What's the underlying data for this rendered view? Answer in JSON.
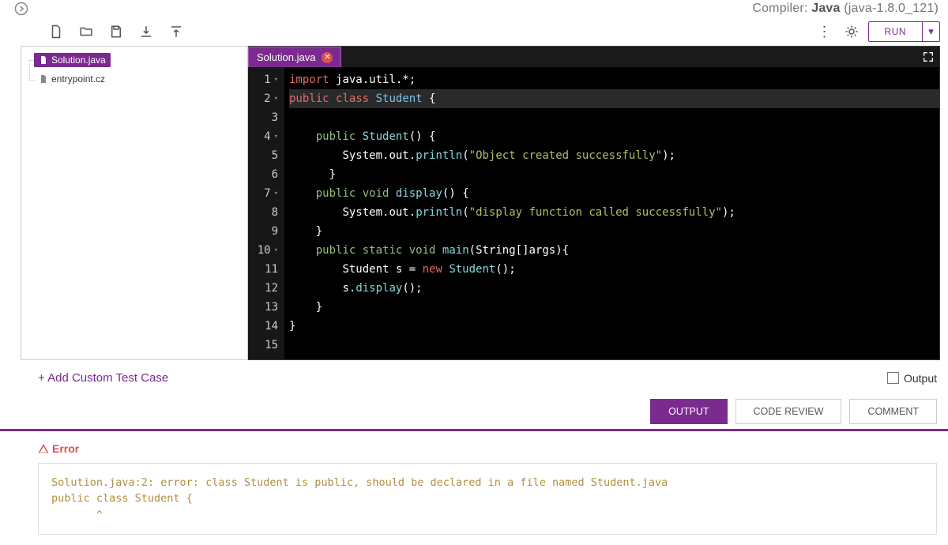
{
  "header": {
    "compiler_prefix": "Compiler: ",
    "compiler_name": "Java",
    "compiler_version": " (java-1.8.0_121)"
  },
  "toolbar": {
    "run_label": "RUN"
  },
  "file_tree": {
    "items": [
      {
        "name": "Solution.java",
        "active": true
      },
      {
        "name": "entrypoint.cz",
        "active": false
      }
    ]
  },
  "editor_tab": {
    "title": "Solution.java"
  },
  "code": {
    "lines": [
      {
        "n": "1",
        "fold": "▾",
        "tokens": [
          [
            "kw-red",
            "import"
          ],
          [
            "pun",
            " "
          ],
          [
            "ident",
            "java"
          ],
          [
            "pun",
            "."
          ],
          [
            "ident",
            "util"
          ],
          [
            "pun",
            ".*;"
          ]
        ]
      },
      {
        "n": "2",
        "fold": "▾",
        "hl": true,
        "tokens": [
          [
            "kw-red",
            "public"
          ],
          [
            "pun",
            " "
          ],
          [
            "kw-red",
            "class"
          ],
          [
            "pun",
            " "
          ],
          [
            "typ",
            "Student"
          ],
          [
            "pun",
            " {"
          ]
        ]
      },
      {
        "n": "3",
        "fold": "",
        "tokens": []
      },
      {
        "n": "4",
        "fold": "▾",
        "tokens": [
          [
            "pun",
            "    "
          ],
          [
            "kw-grn",
            "public"
          ],
          [
            "pun",
            " "
          ],
          [
            "fn",
            "Student"
          ],
          [
            "pun",
            "() {"
          ]
        ]
      },
      {
        "n": "5",
        "fold": "",
        "tokens": [
          [
            "pun",
            "        "
          ],
          [
            "ident",
            "System"
          ],
          [
            "pun",
            "."
          ],
          [
            "ident",
            "out"
          ],
          [
            "pun",
            "."
          ],
          [
            "fn",
            "println"
          ],
          [
            "pun",
            "("
          ],
          [
            "str",
            "\"Object created successfully\""
          ],
          [
            "pun",
            ");"
          ]
        ]
      },
      {
        "n": "6",
        "fold": "",
        "tokens": [
          [
            "pun",
            "      }"
          ]
        ]
      },
      {
        "n": "7",
        "fold": "▾",
        "tokens": [
          [
            "pun",
            "    "
          ],
          [
            "kw-grn",
            "public"
          ],
          [
            "pun",
            " "
          ],
          [
            "kw-grn",
            "void"
          ],
          [
            "pun",
            " "
          ],
          [
            "fn",
            "display"
          ],
          [
            "pun",
            "() {"
          ]
        ]
      },
      {
        "n": "8",
        "fold": "",
        "tokens": [
          [
            "pun",
            "        "
          ],
          [
            "ident",
            "System"
          ],
          [
            "pun",
            "."
          ],
          [
            "ident",
            "out"
          ],
          [
            "pun",
            "."
          ],
          [
            "fn",
            "println"
          ],
          [
            "pun",
            "("
          ],
          [
            "str",
            "\"display function called successfully\""
          ],
          [
            "pun",
            ");"
          ]
        ]
      },
      {
        "n": "9",
        "fold": "",
        "tokens": [
          [
            "pun",
            "    }"
          ]
        ]
      },
      {
        "n": "10",
        "fold": "▾",
        "tokens": [
          [
            "pun",
            "    "
          ],
          [
            "kw-grn",
            "public"
          ],
          [
            "pun",
            " "
          ],
          [
            "kw-grn",
            "static"
          ],
          [
            "pun",
            " "
          ],
          [
            "kw-grn",
            "void"
          ],
          [
            "pun",
            " "
          ],
          [
            "fn",
            "main"
          ],
          [
            "pun",
            "("
          ],
          [
            "ident",
            "String"
          ],
          [
            "pun",
            "[]"
          ],
          [
            "ident",
            "args"
          ],
          [
            "pun",
            "){"
          ]
        ]
      },
      {
        "n": "11",
        "fold": "",
        "tokens": [
          [
            "pun",
            "        "
          ],
          [
            "ident",
            "Student s "
          ],
          [
            "pun",
            "= "
          ],
          [
            "kw-red",
            "new"
          ],
          [
            "pun",
            " "
          ],
          [
            "fn",
            "Student"
          ],
          [
            "pun",
            "();"
          ]
        ]
      },
      {
        "n": "12",
        "fold": "",
        "tokens": [
          [
            "pun",
            "        "
          ],
          [
            "ident",
            "s"
          ],
          [
            "pun",
            "."
          ],
          [
            "fn",
            "display"
          ],
          [
            "pun",
            "();"
          ]
        ]
      },
      {
        "n": "13",
        "fold": "",
        "tokens": [
          [
            "pun",
            "    }"
          ]
        ]
      },
      {
        "n": "14",
        "fold": "",
        "tokens": [
          [
            "pun",
            "}"
          ]
        ]
      },
      {
        "n": "15",
        "fold": "",
        "tokens": []
      }
    ]
  },
  "testcase": {
    "add_label": "+ Add Custom Test Case",
    "output_label": "Output"
  },
  "result_tabs": {
    "output": "OUTPUT",
    "review": "CODE REVIEW",
    "comment": "COMMENT"
  },
  "error": {
    "title": "Error",
    "body": "Solution.java:2: error: class Student is public, should be declared in a file named Student.java\npublic class Student {\n       ^"
  }
}
